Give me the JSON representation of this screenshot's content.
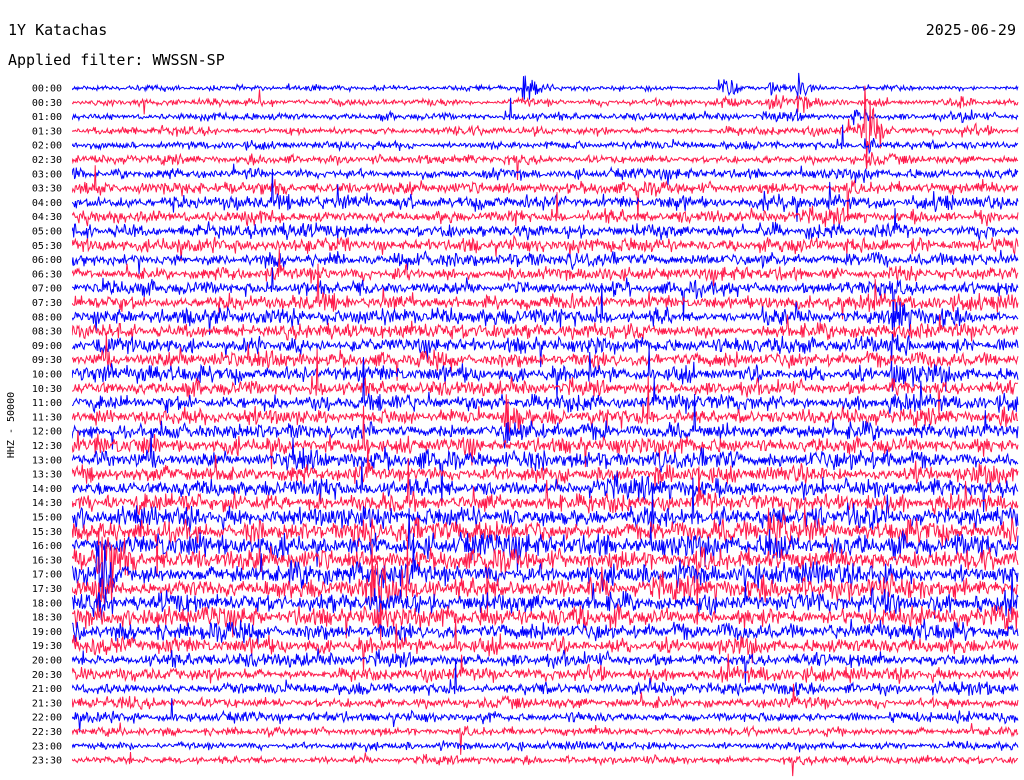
{
  "header": {
    "station": "1Y Katachas",
    "date": "2025-06-29",
    "filter_label": "Applied filter: WWSSN-SP"
  },
  "chart_data": {
    "type": "line",
    "title": "1Y Katachas",
    "subtitle": "Applied filter: WWSSN-SP",
    "ylabel": "HHZ - 50000",
    "xlabel": "",
    "grid": false,
    "legend": "none",
    "row_minutes": 30,
    "series_colors": [
      "#0000ff",
      "#ff1a4a"
    ],
    "row_labels": [
      "00:00",
      "00:30",
      "01:00",
      "01:30",
      "02:00",
      "02:30",
      "03:00",
      "03:30",
      "04:00",
      "04:30",
      "05:00",
      "05:30",
      "06:00",
      "06:30",
      "07:00",
      "07:30",
      "08:00",
      "08:30",
      "09:00",
      "09:30",
      "10:00",
      "10:30",
      "11:00",
      "11:30",
      "12:00",
      "12:30",
      "13:00",
      "13:30",
      "14:00",
      "14:30",
      "15:00",
      "15:30",
      "16:00",
      "16:30",
      "17:00",
      "17:30",
      "18:00",
      "18:30",
      "19:00",
      "19:30",
      "20:00",
      "20:30",
      "21:00",
      "21:30",
      "22:00",
      "22:30",
      "23:00",
      "23:30"
    ],
    "row_activity": [
      0.35,
      0.45,
      0.5,
      0.55,
      0.55,
      0.6,
      0.65,
      0.85,
      0.95,
      0.9,
      0.95,
      1.0,
      0.95,
      0.9,
      0.95,
      1.0,
      1.05,
      1.0,
      1.05,
      1.1,
      1.1,
      1.05,
      1.05,
      1.05,
      1.1,
      1.15,
      1.2,
      1.2,
      1.25,
      1.3,
      1.4,
      1.45,
      1.5,
      1.5,
      1.5,
      1.45,
      1.4,
      1.3,
      1.2,
      1.1,
      1.0,
      0.9,
      0.8,
      0.75,
      0.7,
      0.6,
      0.55,
      0.5
    ],
    "events": [
      {
        "minute": 4,
        "x_frac": 0.48,
        "peak": 5.0
      },
      {
        "minute": 5,
        "x_frac": 0.69,
        "peak": 4.0
      },
      {
        "minute": 8,
        "x_frac": 0.74,
        "peak": 5.0
      },
      {
        "minute": 3,
        "x_frac": 0.77,
        "peak": 6.0
      },
      {
        "minute": 65,
        "x_frac": 0.83,
        "peak": 3.5
      },
      {
        "minute": 95,
        "x_frac": 0.84,
        "peak": 7.0
      },
      {
        "minute": 30,
        "x_frac": 0.94,
        "peak": 4.0
      },
      {
        "minute": 480,
        "x_frac": 0.87,
        "peak": 2.5
      },
      {
        "minute": 620,
        "x_frac": 0.87,
        "peak": 2.5
      },
      {
        "minute": 690,
        "x_frac": 0.46,
        "peak": 2.5
      },
      {
        "minute": 930,
        "x_frac": 0.74,
        "peak": 3.0
      },
      {
        "minute": 1000,
        "x_frac": 0.03,
        "peak": 4.0
      },
      {
        "minute": 1060,
        "x_frac": 0.32,
        "peak": 3.5
      }
    ]
  }
}
